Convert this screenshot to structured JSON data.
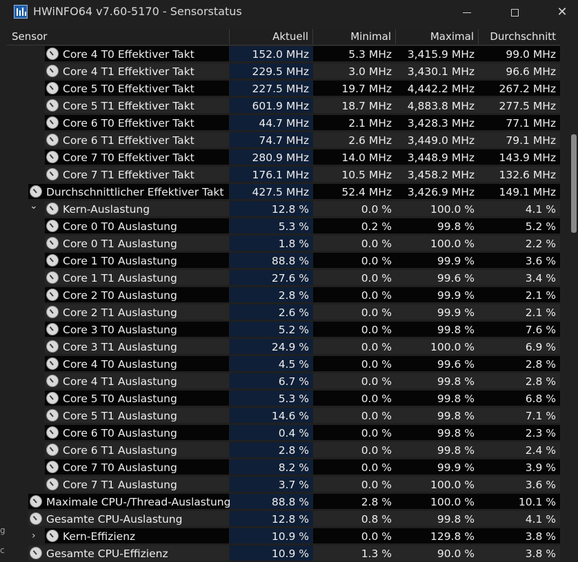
{
  "window": {
    "title": "HWiNFO64 v7.60-5170 - Sensorstatus",
    "icon": "hwinfo-app-icon",
    "controls": {
      "minimize": "minimize-icon",
      "maximize": "maximize-icon",
      "close": "close-icon",
      "close_glyph": "✕"
    }
  },
  "table": {
    "columns": [
      "Sensor",
      "Aktuell",
      "Minimal",
      "Maximal",
      "Durchschnitt"
    ],
    "rows": [
      {
        "label": "Core 4 T0 Effektiver Takt",
        "level": 2,
        "aktuell": "152.0 MHz",
        "minimal": "5.3 MHz",
        "maximal": "3,415.9 MHz",
        "durchschnitt": "99.0 MHz"
      },
      {
        "label": "Core 4 T1 Effektiver Takt",
        "level": 2,
        "aktuell": "229.5 MHz",
        "minimal": "3.0 MHz",
        "maximal": "3,430.1 MHz",
        "durchschnitt": "96.6 MHz"
      },
      {
        "label": "Core 5 T0 Effektiver Takt",
        "level": 2,
        "aktuell": "227.5 MHz",
        "minimal": "19.7 MHz",
        "maximal": "4,442.2 MHz",
        "durchschnitt": "267.2 MHz"
      },
      {
        "label": "Core 5 T1 Effektiver Takt",
        "level": 2,
        "aktuell": "601.9 MHz",
        "minimal": "18.7 MHz",
        "maximal": "4,883.8 MHz",
        "durchschnitt": "277.5 MHz"
      },
      {
        "label": "Core 6 T0 Effektiver Takt",
        "level": 2,
        "aktuell": "44.7 MHz",
        "minimal": "2.1 MHz",
        "maximal": "3,428.3 MHz",
        "durchschnitt": "77.1 MHz"
      },
      {
        "label": "Core 6 T1 Effektiver Takt",
        "level": 2,
        "aktuell": "74.7 MHz",
        "minimal": "2.6 MHz",
        "maximal": "3,449.0 MHz",
        "durchschnitt": "79.1 MHz"
      },
      {
        "label": "Core 7 T0 Effektiver Takt",
        "level": 2,
        "aktuell": "280.9 MHz",
        "minimal": "14.0 MHz",
        "maximal": "3,448.9 MHz",
        "durchschnitt": "143.9 MHz"
      },
      {
        "label": "Core 7 T1 Effektiver Takt",
        "level": 2,
        "aktuell": "176.1 MHz",
        "minimal": "10.5 MHz",
        "maximal": "3,458.2 MHz",
        "durchschnitt": "132.6 MHz"
      },
      {
        "label": "Durchschnittlicher Effektiver Takt",
        "level": 1,
        "aktuell": "427.5 MHz",
        "minimal": "52.4 MHz",
        "maximal": "3,426.9 MHz",
        "durchschnitt": "149.1 MHz"
      },
      {
        "label": "Kern-Auslastung",
        "level": 2,
        "expander": "expanded",
        "aktuell": "12.8 %",
        "minimal": "0.0 %",
        "maximal": "100.0 %",
        "durchschnitt": "4.1 %"
      },
      {
        "label": "Core 0 T0 Auslastung",
        "level": 2,
        "aktuell": "5.3 %",
        "minimal": "0.2 %",
        "maximal": "99.8 %",
        "durchschnitt": "5.2 %"
      },
      {
        "label": "Core 0 T1 Auslastung",
        "level": 2,
        "aktuell": "1.8 %",
        "minimal": "0.0 %",
        "maximal": "100.0 %",
        "durchschnitt": "2.2 %"
      },
      {
        "label": "Core 1 T0 Auslastung",
        "level": 2,
        "aktuell": "88.8 %",
        "minimal": "0.0 %",
        "maximal": "99.9 %",
        "durchschnitt": "3.6 %"
      },
      {
        "label": "Core 1 T1 Auslastung",
        "level": 2,
        "aktuell": "27.6 %",
        "minimal": "0.0 %",
        "maximal": "99.6 %",
        "durchschnitt": "3.4 %"
      },
      {
        "label": "Core 2 T0 Auslastung",
        "level": 2,
        "aktuell": "2.8 %",
        "minimal": "0.0 %",
        "maximal": "99.9 %",
        "durchschnitt": "2.1 %"
      },
      {
        "label": "Core 2 T1 Auslastung",
        "level": 2,
        "aktuell": "2.6 %",
        "minimal": "0.0 %",
        "maximal": "99.9 %",
        "durchschnitt": "2.1 %"
      },
      {
        "label": "Core 3 T0 Auslastung",
        "level": 2,
        "aktuell": "5.2 %",
        "minimal": "0.0 %",
        "maximal": "99.8 %",
        "durchschnitt": "7.6 %"
      },
      {
        "label": "Core 3 T1 Auslastung",
        "level": 2,
        "aktuell": "24.9 %",
        "minimal": "0.0 %",
        "maximal": "100.0 %",
        "durchschnitt": "6.9 %"
      },
      {
        "label": "Core 4 T0 Auslastung",
        "level": 2,
        "aktuell": "4.5 %",
        "minimal": "0.0 %",
        "maximal": "99.6 %",
        "durchschnitt": "2.8 %"
      },
      {
        "label": "Core 4 T1 Auslastung",
        "level": 2,
        "aktuell": "6.7 %",
        "minimal": "0.0 %",
        "maximal": "99.8 %",
        "durchschnitt": "2.8 %"
      },
      {
        "label": "Core 5 T0 Auslastung",
        "level": 2,
        "aktuell": "5.3 %",
        "minimal": "0.0 %",
        "maximal": "99.8 %",
        "durchschnitt": "6.8 %"
      },
      {
        "label": "Core 5 T1 Auslastung",
        "level": 2,
        "aktuell": "14.6 %",
        "minimal": "0.0 %",
        "maximal": "99.8 %",
        "durchschnitt": "7.1 %"
      },
      {
        "label": "Core 6 T0 Auslastung",
        "level": 2,
        "aktuell": "0.4 %",
        "minimal": "0.0 %",
        "maximal": "99.8 %",
        "durchschnitt": "2.3 %"
      },
      {
        "label": "Core 6 T1 Auslastung",
        "level": 2,
        "aktuell": "2.8 %",
        "minimal": "0.0 %",
        "maximal": "99.8 %",
        "durchschnitt": "2.4 %"
      },
      {
        "label": "Core 7 T0 Auslastung",
        "level": 2,
        "aktuell": "8.2 %",
        "minimal": "0.0 %",
        "maximal": "99.9 %",
        "durchschnitt": "3.9 %"
      },
      {
        "label": "Core 7 T1 Auslastung",
        "level": 2,
        "aktuell": "3.7 %",
        "minimal": "0.0 %",
        "maximal": "100.0 %",
        "durchschnitt": "3.6 %"
      },
      {
        "label": "Maximale CPU-/Thread-Auslastung",
        "level": 1,
        "aktuell": "88.8 %",
        "minimal": "2.8 %",
        "maximal": "100.0 %",
        "durchschnitt": "10.1 %"
      },
      {
        "label": "Gesamte CPU-Auslastung",
        "level": 1,
        "aktuell": "12.8 %",
        "minimal": "0.8 %",
        "maximal": "99.8 %",
        "durchschnitt": "4.1 %"
      },
      {
        "label": "Kern-Effizienz",
        "level": 2,
        "expander": "collapsed",
        "aktuell": "10.9 %",
        "minimal": "0.0 %",
        "maximal": "129.8 %",
        "durchschnitt": "3.8 %"
      },
      {
        "label": "Gesamte CPU-Effizienz",
        "level": 1,
        "aktuell": "10.9 %",
        "minimal": "1.3 %",
        "maximal": "90.0 %",
        "durchschnitt": "3.8 %"
      }
    ]
  },
  "expander_glyphs": {
    "expanded": "⌄",
    "collapsed": "›"
  },
  "icons": {
    "sensor": "gauge-icon",
    "expanded": "chevron-down-icon",
    "collapsed": "chevron-right-icon"
  },
  "colors": {
    "aktuell_bg": "#0f1f37",
    "row_dark": "#050505",
    "row_light": "#262626",
    "window_bg": "#202020"
  },
  "edge_text": [
    "g",
    "c"
  ]
}
